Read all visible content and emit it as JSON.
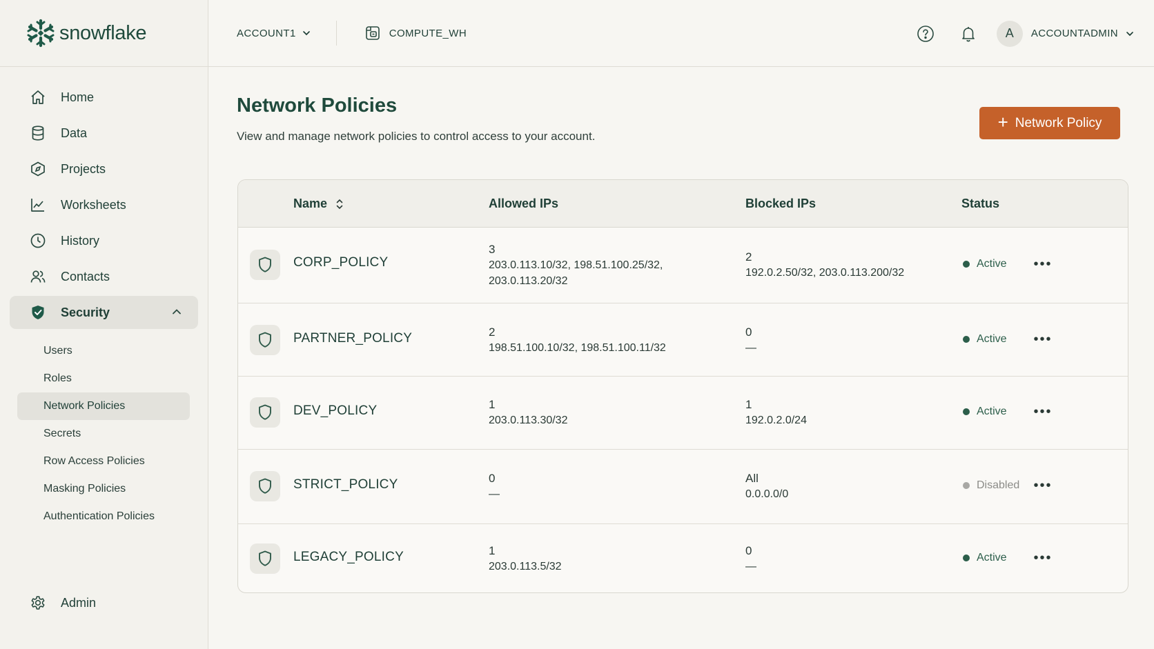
{
  "brand": {
    "name": "snowflake"
  },
  "sidebar": {
    "items": [
      {
        "label": "Home",
        "icon": "home-icon"
      },
      {
        "label": "Data",
        "icon": "database-icon"
      },
      {
        "label": "Projects",
        "icon": "compass-icon"
      },
      {
        "label": "Worksheets",
        "icon": "chart-line-icon"
      },
      {
        "label": "History",
        "icon": "clock-icon"
      },
      {
        "label": "Contacts",
        "icon": "users-icon"
      },
      {
        "label": "Security",
        "icon": "shield-check-icon",
        "expanded": true
      }
    ],
    "security_sub": [
      "Users",
      "Roles",
      "Network Policies",
      "Secrets",
      "Row Access Policies",
      "Masking Policies",
      "Authentication Policies"
    ],
    "active_sub": "Network Policies",
    "admin": {
      "label": "Admin",
      "icon": "gear-icon"
    }
  },
  "topbar": {
    "account": "ACCOUNT1",
    "warehouse": "COMPUTE_WH",
    "avatar_initial": "A",
    "role": "ACCOUNTADMIN"
  },
  "page": {
    "title": "Network Policies",
    "subtitle": "View and manage network policies to control access to your account.",
    "create_button": "Network Policy",
    "create_button_icon": "+"
  },
  "table": {
    "columns": {
      "name": "Name",
      "allowed": "Allowed IPs",
      "blocked": "Blocked IPs",
      "status": "Status"
    },
    "rows": [
      {
        "name": "CORP_POLICY",
        "allowed_count": "3",
        "allowed_ips_1": "203.0.113.10/32, 198.51.100.25/32,",
        "allowed_ips_2": "203.0.113.20/32",
        "blocked_count": "2",
        "blocked_ips": "192.0.2.50/32, 203.0.113.200/32",
        "status": "Active"
      },
      {
        "name": "PARTNER_POLICY",
        "allowed_count": "2",
        "allowed_ips_1": "198.51.100.10/32, 198.51.100.11/32",
        "allowed_ips_2": "",
        "blocked_count": "0",
        "blocked_ips": "—",
        "status": "Active"
      },
      {
        "name": "DEV_POLICY",
        "allowed_count": "1",
        "allowed_ips_1": "203.0.113.30/32",
        "allowed_ips_2": "",
        "blocked_count": "1",
        "blocked_ips": "192.0.2.0/24",
        "status": "Active"
      },
      {
        "name": "STRICT_POLICY",
        "allowed_count": "0",
        "allowed_ips_1": "—",
        "allowed_ips_2": "",
        "blocked_count": "All",
        "blocked_ips": "0.0.0.0/0",
        "status": "Disabled"
      },
      {
        "name": "LEGACY_POLICY",
        "allowed_count": "1",
        "allowed_ips_1": "203.0.113.5/32",
        "allowed_ips_2": "",
        "blocked_count": "0",
        "blocked_ips": "—",
        "status": "Active"
      }
    ],
    "more_glyph": "•••"
  },
  "colors": {
    "brand": "#1f4a3c",
    "primary_button": "#c5612a",
    "active_status": "#2c5e4a",
    "disabled_status": "#a8a8a4"
  }
}
